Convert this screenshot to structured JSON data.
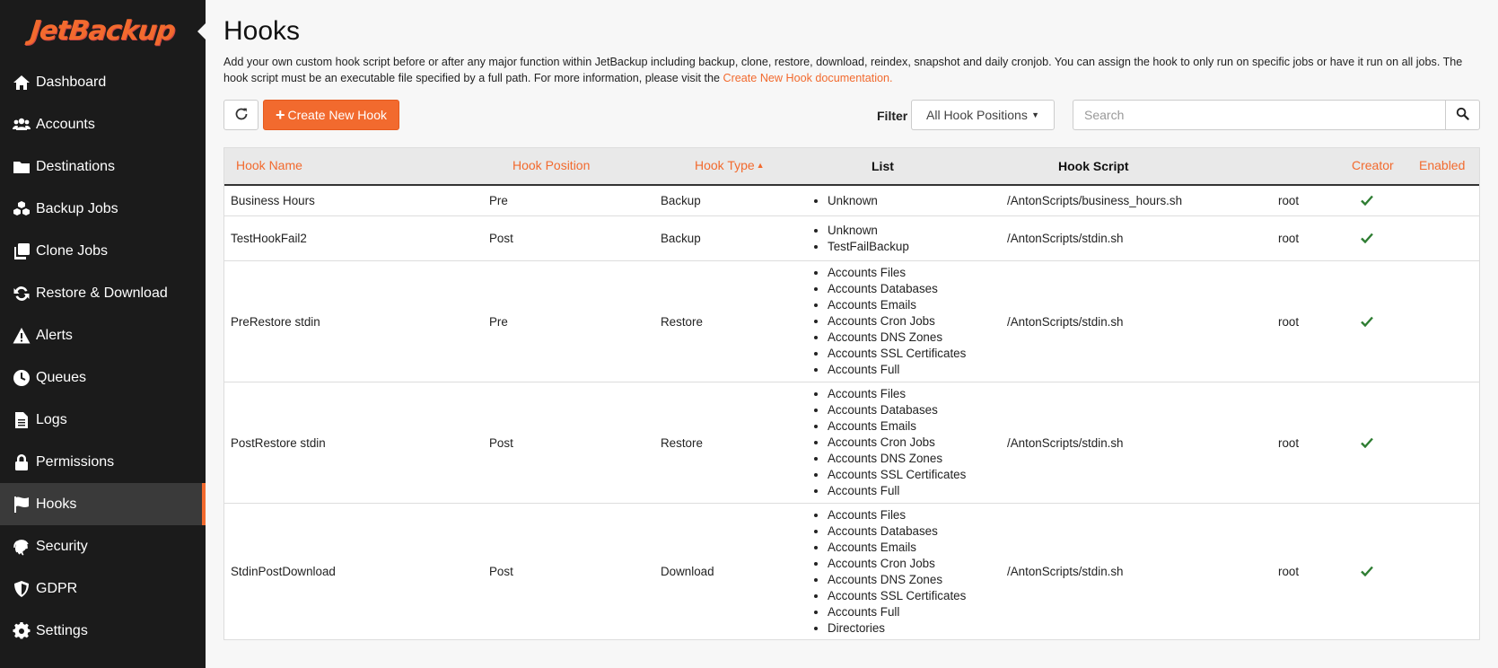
{
  "logo": {
    "text": "JetBackup"
  },
  "sidebar": {
    "items": [
      {
        "label": "Dashboard",
        "icon": "home-icon"
      },
      {
        "label": "Accounts",
        "icon": "users-icon"
      },
      {
        "label": "Destinations",
        "icon": "folder-icon"
      },
      {
        "label": "Backup Jobs",
        "icon": "cubes-icon"
      },
      {
        "label": "Clone Jobs",
        "icon": "clone-icon"
      },
      {
        "label": "Restore & Download",
        "icon": "sync-icon"
      },
      {
        "label": "Alerts",
        "icon": "warning-icon"
      },
      {
        "label": "Queues",
        "icon": "clock-icon"
      },
      {
        "label": "Logs",
        "icon": "file-icon"
      },
      {
        "label": "Permissions",
        "icon": "lock-icon"
      },
      {
        "label": "Hooks",
        "icon": "flag-icon",
        "active": true
      },
      {
        "label": "Security",
        "icon": "fingerprint-icon"
      },
      {
        "label": "GDPR",
        "icon": "shield-icon"
      },
      {
        "label": "Settings",
        "icon": "gear-icon"
      }
    ]
  },
  "page": {
    "title": "Hooks",
    "description": "Add your own custom hook script before or after any major function within JetBackup including backup, clone, restore, download, reindex, snapshot and daily cronjob. You can assign the hook to only run on specific jobs or have it run on all jobs. The hook script must be an executable file specified by a full path. For more information, please visit the ",
    "description_link": "Create New Hook documentation."
  },
  "toolbar": {
    "refresh_icon": "refresh-icon",
    "create_label": "Create New Hook",
    "filter_label": "Filter",
    "filter_value": "All Hook Positions",
    "search_placeholder": "Search",
    "search_icon": "search-icon"
  },
  "table": {
    "headers": {
      "name": "Hook Name",
      "position": "Hook Position",
      "type": "Hook Type",
      "list": "List",
      "script": "Hook Script",
      "creator": "Creator",
      "enabled": "Enabled"
    },
    "rows": [
      {
        "name": "Business Hours",
        "position": "Pre",
        "type": "Backup",
        "list": [
          "Unknown"
        ],
        "script": "/AntonScripts/business_hours.sh",
        "creator": "root",
        "enabled": true
      },
      {
        "name": "TestHookFail2",
        "position": "Post",
        "type": "Backup",
        "list": [
          "Unknown",
          "TestFailBackup"
        ],
        "script": "/AntonScripts/stdin.sh",
        "creator": "root",
        "enabled": true
      },
      {
        "name": "PreRestore stdin",
        "position": "Pre",
        "type": "Restore",
        "list": [
          "Accounts Files",
          "Accounts Databases",
          "Accounts Emails",
          "Accounts Cron Jobs",
          "Accounts DNS Zones",
          "Accounts SSL Certificates",
          "Accounts Full"
        ],
        "script": "/AntonScripts/stdin.sh",
        "creator": "root",
        "enabled": true
      },
      {
        "name": "PostRestore stdin",
        "position": "Post",
        "type": "Restore",
        "list": [
          "Accounts Files",
          "Accounts Databases",
          "Accounts Emails",
          "Accounts Cron Jobs",
          "Accounts DNS Zones",
          "Accounts SSL Certificates",
          "Accounts Full"
        ],
        "script": "/AntonScripts/stdin.sh",
        "creator": "root",
        "enabled": true
      },
      {
        "name": "StdinPostDownload",
        "position": "Post",
        "type": "Download",
        "list": [
          "Accounts Files",
          "Accounts Databases",
          "Accounts Emails",
          "Accounts Cron Jobs",
          "Accounts DNS Zones",
          "Accounts SSL Certificates",
          "Accounts Full",
          "Directories"
        ],
        "script": "/AntonScripts/stdin.sh",
        "creator": "root",
        "enabled": true
      }
    ]
  },
  "colors": {
    "accent": "#f26a2e",
    "sidebar_bg": "#1b1b1b",
    "check": "#2e7d32"
  }
}
